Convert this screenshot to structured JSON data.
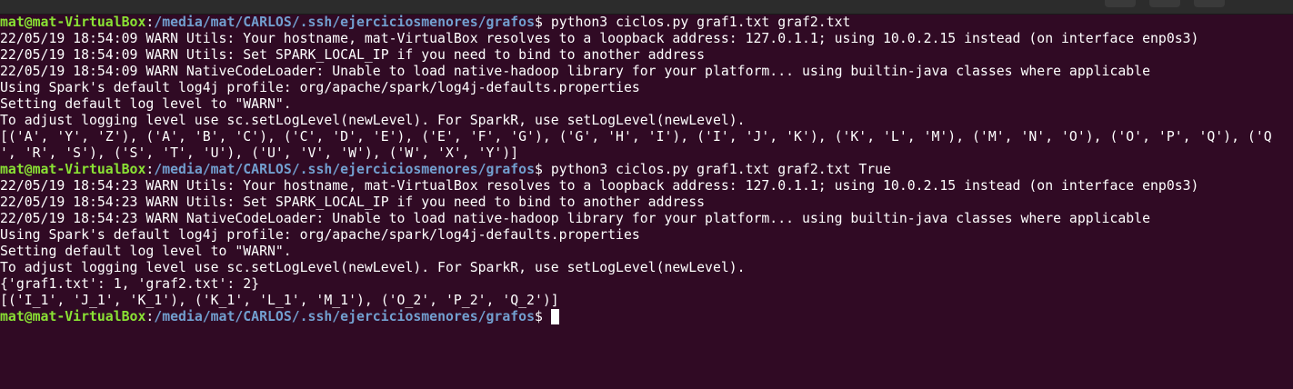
{
  "terminal": {
    "prompt": {
      "user_host": "mat@mat-VirtualBox",
      "colon": ":",
      "path": "/media/mat/CARLOS/.ssh/ejerciciosmenores/grafos",
      "symbol": "$"
    },
    "lines": [
      {
        "type": "prompt",
        "command": " python3 ciclos.py graf1.txt graf2.txt"
      },
      {
        "type": "output",
        "text": "22/05/19 18:54:09 WARN Utils: Your hostname, mat-VirtualBox resolves to a loopback address: 127.0.1.1; using 10.0.2.15 instead (on interface enp0s3)"
      },
      {
        "type": "output",
        "text": "22/05/19 18:54:09 WARN Utils: Set SPARK_LOCAL_IP if you need to bind to another address"
      },
      {
        "type": "output",
        "text": "22/05/19 18:54:09 WARN NativeCodeLoader: Unable to load native-hadoop library for your platform... using builtin-java classes where applicable"
      },
      {
        "type": "output",
        "text": "Using Spark's default log4j profile: org/apache/spark/log4j-defaults.properties"
      },
      {
        "type": "output",
        "text": "Setting default log level to \"WARN\"."
      },
      {
        "type": "output",
        "text": "To adjust logging level use sc.setLogLevel(newLevel). For SparkR, use setLogLevel(newLevel)."
      },
      {
        "type": "output",
        "text": "[('A', 'Y', 'Z'), ('A', 'B', 'C'), ('C', 'D', 'E'), ('E', 'F', 'G'), ('G', 'H', 'I'), ('I', 'J', 'K'), ('K', 'L', 'M'), ('M', 'N', 'O'), ('O', 'P', 'Q'), ('Q"
      },
      {
        "type": "output",
        "text": "', 'R', 'S'), ('S', 'T', 'U'), ('U', 'V', 'W'), ('W', 'X', 'Y')]"
      },
      {
        "type": "prompt",
        "command": " python3 ciclos.py graf1.txt graf2.txt True"
      },
      {
        "type": "output",
        "text": "22/05/19 18:54:23 WARN Utils: Your hostname, mat-VirtualBox resolves to a loopback address: 127.0.1.1; using 10.0.2.15 instead (on interface enp0s3)"
      },
      {
        "type": "output",
        "text": "22/05/19 18:54:23 WARN Utils: Set SPARK_LOCAL_IP if you need to bind to another address"
      },
      {
        "type": "output",
        "text": "22/05/19 18:54:23 WARN NativeCodeLoader: Unable to load native-hadoop library for your platform... using builtin-java classes where applicable"
      },
      {
        "type": "output",
        "text": "Using Spark's default log4j profile: org/apache/spark/log4j-defaults.properties"
      },
      {
        "type": "output",
        "text": "Setting default log level to \"WARN\"."
      },
      {
        "type": "output",
        "text": "To adjust logging level use sc.setLogLevel(newLevel). For SparkR, use setLogLevel(newLevel)."
      },
      {
        "type": "output",
        "text": "{'graf1.txt': 1, 'graf2.txt': 2}"
      },
      {
        "type": "output",
        "text": "[('I_1', 'J_1', 'K_1'), ('K_1', 'L_1', 'M_1'), ('O_2', 'P_2', 'Q_2')]"
      },
      {
        "type": "prompt",
        "command": " ",
        "cursor": true
      }
    ]
  },
  "colors": {
    "background": "#300a24",
    "user_host": "#8ae234",
    "path": "#729fcf",
    "text": "#ffffff"
  }
}
